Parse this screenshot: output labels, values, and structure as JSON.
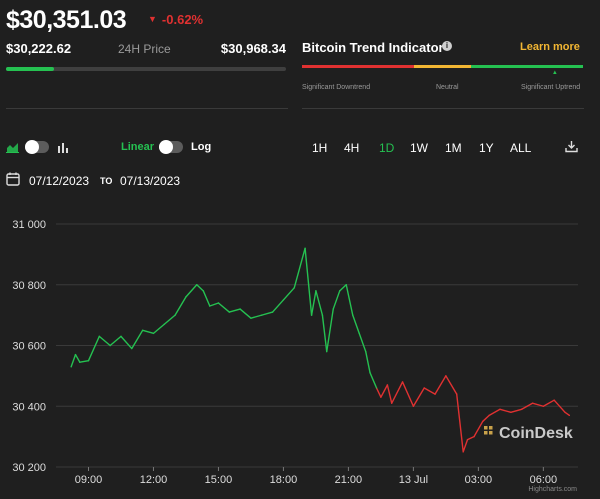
{
  "header": {
    "price": "$30,351.03",
    "change": "-0.62%",
    "low": "$30,222.62",
    "range_label": "24H Price",
    "high": "$30,968.34",
    "range_position": 0.17
  },
  "trend": {
    "title": "Bitcoin Trend Indicator",
    "learn_more": "Learn more",
    "labels": [
      "Significant Downtrend",
      "Neutral",
      "Significant Uptrend"
    ],
    "segments": [
      {
        "color": "#e03131",
        "share": 0.4
      },
      {
        "color": "#f2b633",
        "share": 0.2
      },
      {
        "color": "#25c151",
        "share": 0.4
      }
    ],
    "level": 0.9
  },
  "controls": {
    "linear": "Linear",
    "log": "Log",
    "timeframes": [
      "1H",
      "4H",
      "1D",
      "1W",
      "1M",
      "1Y",
      "ALL"
    ],
    "active_timeframe": "1D",
    "date_from": "07/12/2023",
    "to": "TO",
    "date_to": "07/13/2023"
  },
  "colors": {
    "up": "#25c151",
    "down": "#e03131",
    "accent": "#f2b633"
  },
  "chart_data": {
    "type": "line",
    "x_tick_labels": [
      "09:00",
      "12:00",
      "15:00",
      "18:00",
      "21:00",
      "13 Jul",
      "03:00",
      "06:00"
    ],
    "y_tick_labels": [
      "31 000",
      "30 800",
      "30 600",
      "30 400",
      "30 200"
    ],
    "ylim": [
      30200,
      31000
    ],
    "x_hours": [
      8.2,
      8.4,
      8.6,
      9.0,
      9.5,
      10.0,
      10.5,
      11.0,
      11.5,
      12.0,
      12.5,
      13.0,
      13.5,
      14.0,
      14.3,
      14.6,
      15.0,
      15.5,
      16.0,
      16.5,
      17.0,
      17.5,
      18.0,
      18.5,
      19.0,
      19.3,
      19.5,
      19.8,
      20.0,
      20.3,
      20.6,
      20.9,
      21.2,
      21.5,
      21.8,
      22.0,
      22.3,
      22.5,
      22.8,
      23.0,
      23.5,
      24.0,
      24.5,
      25.0,
      25.5,
      26.0,
      26.3,
      26.5,
      26.8,
      27.2,
      27.5,
      28.0,
      28.5,
      29.0,
      29.5,
      30.0,
      30.5,
      31.0,
      31.2
    ],
    "values": [
      30530,
      30570,
      30545,
      30550,
      30630,
      30600,
      30630,
      30590,
      30650,
      30640,
      30670,
      30700,
      30760,
      30800,
      30780,
      30730,
      30740,
      30710,
      30720,
      30690,
      30700,
      30710,
      30750,
      30790,
      30920,
      30700,
      30780,
      30700,
      30580,
      30720,
      30780,
      30800,
      30700,
      30640,
      30580,
      30510,
      30460,
      30430,
      30470,
      30410,
      30480,
      30400,
      30460,
      30440,
      30500,
      30440,
      30250,
      30290,
      30300,
      30350,
      30370,
      30390,
      30380,
      30390,
      30410,
      30400,
      30420,
      30380,
      30370
    ],
    "grid": true,
    "watermark": "CoinDesk",
    "credit": "Highcharts.com"
  }
}
